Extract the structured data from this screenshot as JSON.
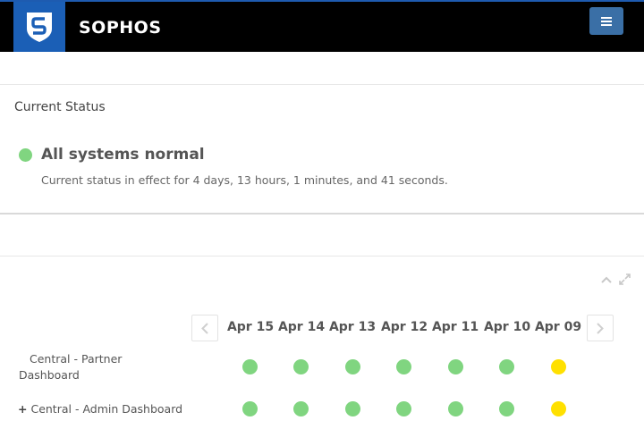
{
  "header": {
    "brand": "SOPHOS",
    "logo_icon": "shield-s-icon",
    "menu_icon": "hamburger-icon"
  },
  "status": {
    "heading": "Current Status",
    "title": "All systems normal",
    "description": "Current status in effect for 4 days, 13 hours, 1 minutes, and 41 seconds.",
    "color": "#80d580"
  },
  "history": {
    "controls": [
      "collapse-icon",
      "expand-icon"
    ],
    "dates": [
      "Apr 15",
      "Apr 14",
      "Apr 13",
      "Apr 12",
      "Apr 11",
      "Apr 10",
      "Apr 09"
    ],
    "colors": {
      "operational": "#80d580",
      "degraded": "#ffe000"
    },
    "rows": [
      {
        "label": "Central - Partner Dashboard",
        "statuses": [
          "operational",
          "operational",
          "operational",
          "operational",
          "operational",
          "operational",
          "degraded"
        ]
      },
      {
        "label": "Central - Admin Dashboard",
        "expand_icon": "plus-icon",
        "statuses": [
          "operational",
          "operational",
          "operational",
          "operational",
          "operational",
          "operational",
          "degraded"
        ]
      }
    ]
  }
}
